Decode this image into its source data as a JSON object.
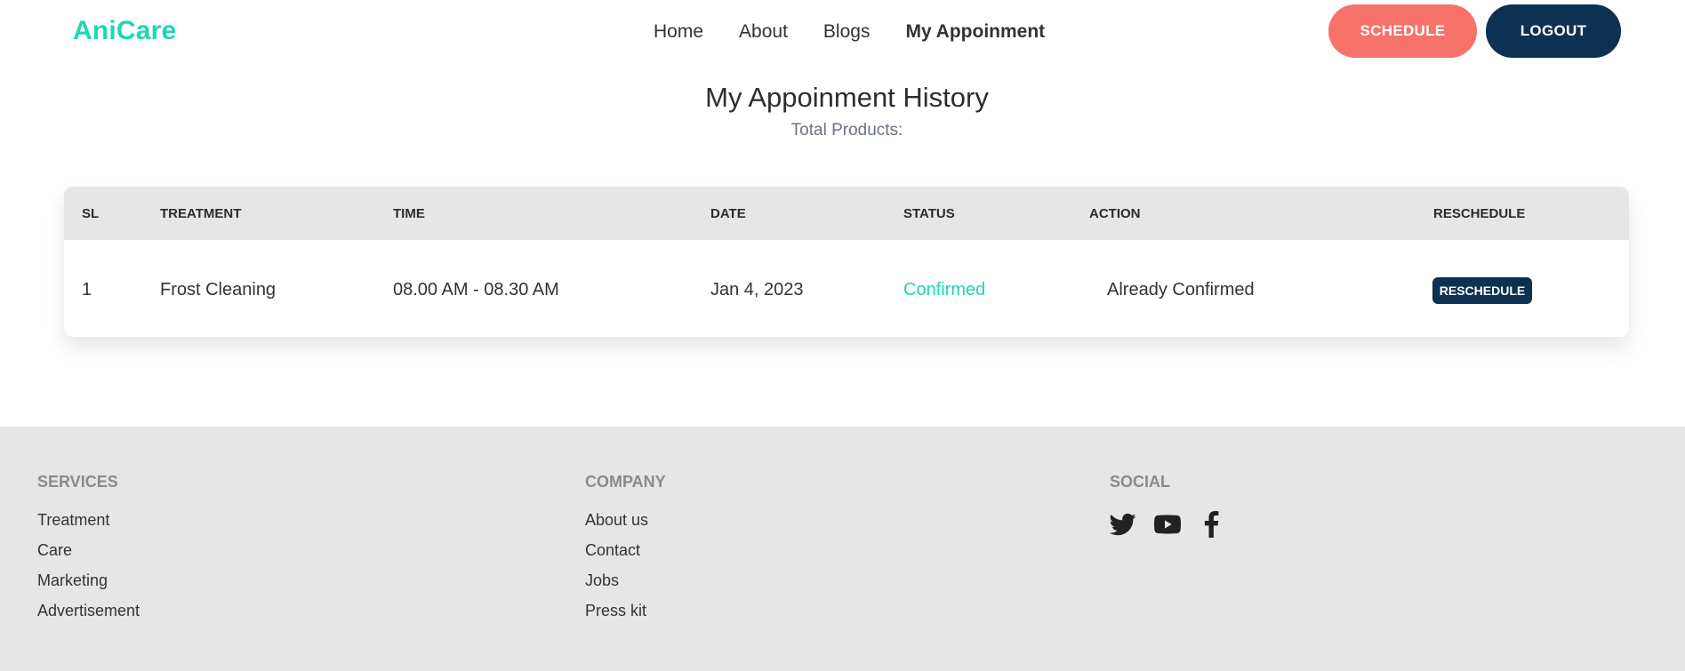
{
  "nav": {
    "brand": "AniCare",
    "links": [
      "Home",
      "About",
      "Blogs",
      "My Appoinment"
    ],
    "schedule_label": "SCHEDULE",
    "logout_label": "LOGOUT"
  },
  "page": {
    "title": "My Appoinment History",
    "subtitle": "Total Products:"
  },
  "table": {
    "headers": [
      "SL",
      "TREATMENT",
      "TIME",
      "DATE",
      "STATUS",
      "ACTION",
      "RESCHEDULE"
    ],
    "rows": [
      {
        "sl": "1",
        "treatment": "Frost Cleaning",
        "time": "08.00 AM - 08.30 AM",
        "date": "Jan 4, 2023",
        "status": "Confirmed",
        "action": "Already Confirmed",
        "reschedule_label": "RESCHEDULE"
      }
    ]
  },
  "footer": {
    "services": {
      "heading": "SERVICES",
      "links": [
        "Treatment",
        "Care",
        "Marketing",
        "Advertisement"
      ]
    },
    "company": {
      "heading": "COMPANY",
      "links": [
        "About us",
        "Contact",
        "Jobs",
        "Press kit"
      ]
    },
    "social": {
      "heading": "SOCIAL",
      "icons": [
        "twitter-icon",
        "youtube-icon",
        "facebook-icon"
      ]
    }
  },
  "colors": {
    "brand": "#1ed6b4",
    "schedule_button": "#f7726a",
    "navy": "#0d3152",
    "status_confirmed": "#1ed6b4",
    "table_header_bg": "#e6e6e6",
    "footer_bg": "#e6e6e6"
  }
}
